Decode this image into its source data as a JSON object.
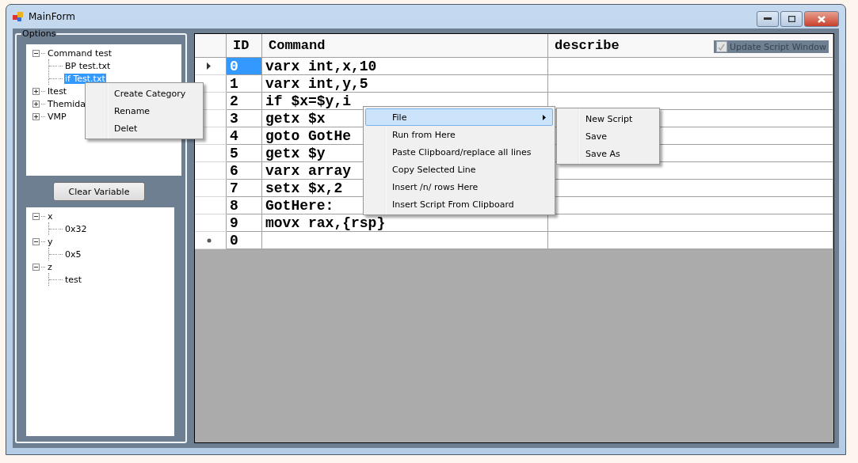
{
  "window": {
    "title": "MainForm"
  },
  "options": {
    "title": "Options",
    "tree": [
      {
        "label": "Command test",
        "expanded": true,
        "selected": false,
        "children": [
          {
            "label": "BP test.txt",
            "selected": false
          },
          {
            "label": "if Test.txt",
            "selected": true
          }
        ]
      },
      {
        "label": "ltest",
        "expanded": false,
        "selected": false
      },
      {
        "label": "Themida",
        "expanded": false,
        "selected": false
      },
      {
        "label": "VMP",
        "expanded": false,
        "selected": false
      }
    ]
  },
  "tree_menu": [
    "Create Category",
    "Rename",
    "Delet"
  ],
  "clear_button": "Clear Variable",
  "variables": [
    {
      "label": "x",
      "expanded": true,
      "children": [
        {
          "label": "0x32"
        }
      ]
    },
    {
      "label": "y",
      "expanded": true,
      "children": [
        {
          "label": "0x5"
        }
      ]
    },
    {
      "label": "z",
      "expanded": true,
      "children": [
        {
          "label": "test"
        }
      ]
    }
  ],
  "update_checkbox": {
    "label": "Update Script Window",
    "checked": true,
    "disabled": true
  },
  "table": {
    "columns": [
      "ID",
      "Command",
      "describe"
    ],
    "rows": [
      {
        "kind": "row",
        "current": true,
        "id": "0",
        "id_selected": true,
        "command": "varx int,x,10"
      },
      {
        "kind": "row",
        "current": false,
        "id": "1",
        "id_selected": false,
        "command": "varx int,y,5"
      },
      {
        "kind": "row",
        "current": false,
        "id": "2",
        "id_selected": false,
        "command": "if $x=$y,i"
      },
      {
        "kind": "row",
        "current": false,
        "id": "3",
        "id_selected": false,
        "command": "getx $x"
      },
      {
        "kind": "row",
        "current": false,
        "id": "4",
        "id_selected": false,
        "command": "goto GotHe"
      },
      {
        "kind": "row",
        "current": false,
        "id": "5",
        "id_selected": false,
        "command": "getx $y"
      },
      {
        "kind": "row",
        "current": false,
        "id": "6",
        "id_selected": false,
        "command": "varx array"
      },
      {
        "kind": "row",
        "current": false,
        "id": "7",
        "id_selected": false,
        "command": "setx $x,2"
      },
      {
        "kind": "row",
        "current": false,
        "id": "8",
        "id_selected": false,
        "command": "GotHere:"
      },
      {
        "kind": "row",
        "current": false,
        "id": "9",
        "id_selected": false,
        "command": "movx rax,{rsp}"
      },
      {
        "kind": "new",
        "current": false,
        "id": "0",
        "id_selected": false,
        "command": ""
      }
    ]
  },
  "grid_menu": [
    {
      "label": "File",
      "submenu": true,
      "selected": true
    },
    {
      "label": "Run from Here",
      "submenu": false,
      "selected": false
    },
    {
      "label": "Paste Clipboard/replace all lines",
      "submenu": false,
      "selected": false
    },
    {
      "label": "Copy Selected Line",
      "submenu": false,
      "selected": false
    },
    {
      "label": "Insert /n/ rows Here",
      "submenu": false,
      "selected": false
    },
    {
      "label": "Insert Script From Clipboard",
      "submenu": false,
      "selected": false
    }
  ],
  "file_submenu": [
    "New Script",
    "Save",
    "Save As"
  ]
}
